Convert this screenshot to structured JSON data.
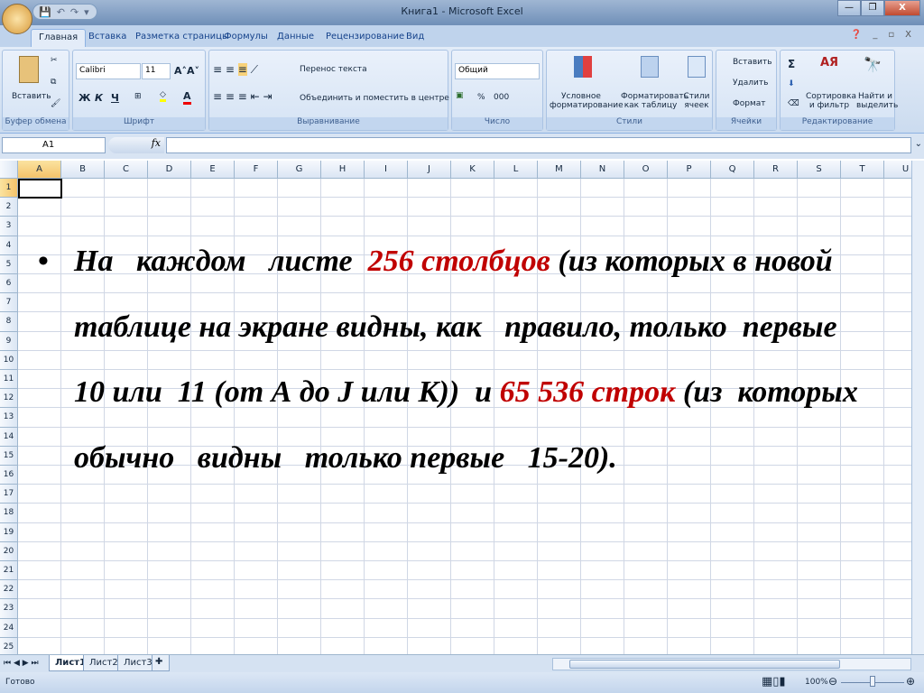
{
  "window": {
    "title": "Книга1 - Microsoft Excel",
    "qat": [
      "save",
      "undo",
      "redo",
      "customize"
    ]
  },
  "tabs": [
    "Главная",
    "Вставка",
    "Разметка страницы",
    "Формулы",
    "Данные",
    "Рецензирование",
    "Вид"
  ],
  "ribbon": {
    "clipboard": {
      "paste": "Вставить",
      "label": "Буфер обмена"
    },
    "font": {
      "name": "Calibri",
      "size": "11",
      "bold": "Ж",
      "italic": "К",
      "underline": "Ч",
      "label": "Шрифт"
    },
    "alignment": {
      "wrap": "Перенос текста",
      "merge": "Объединить и поместить в центре",
      "label": "Выравнивание"
    },
    "number": {
      "format": "Общий",
      "percent": "%",
      "thousands": "000",
      "label": "Число"
    },
    "styles": {
      "conditional": "Условное форматирование",
      "table": "Форматировать как таблицу",
      "cell": "Стили ячеек",
      "label": "Стили"
    },
    "cells": {
      "insert": "Вставить",
      "delete": "Удалить",
      "format": "Формат",
      "label": "Ячейки"
    },
    "editing": {
      "sort": "Сортировка и фильтр",
      "find": "Найти и выделить",
      "sum": "Σ",
      "label": "Редактирование"
    }
  },
  "formula_bar": {
    "name_box": "A1",
    "fx": "fx",
    "value": ""
  },
  "columns": [
    "A",
    "B",
    "C",
    "D",
    "E",
    "F",
    "G",
    "H",
    "I",
    "J",
    "K",
    "L",
    "M",
    "N",
    "O",
    "P",
    "Q",
    "R",
    "S",
    "T",
    "U"
  ],
  "rows": [
    "1",
    "2",
    "3",
    "4",
    "5",
    "6",
    "7",
    "8",
    "9",
    "10",
    "11",
    "12",
    "13",
    "14",
    "15",
    "16",
    "17",
    "18",
    "19",
    "20",
    "21",
    "22",
    "23",
    "24",
    "25"
  ],
  "overlay": {
    "bullet": "•",
    "parts": [
      "На   каждом   листе  ",
      "256 столбцов",
      " (из которых в новой таблице на экране видны, как   правило, только  первые  10 или  11 (от А до J или К))  и ",
      "65 536 строк",
      " (из  которых   обычно   видны   только первые   15-20)."
    ]
  },
  "sheets": [
    "Лист1",
    "Лист2",
    "Лист3"
  ],
  "status": {
    "text": "Готово",
    "zoom": "100%"
  }
}
